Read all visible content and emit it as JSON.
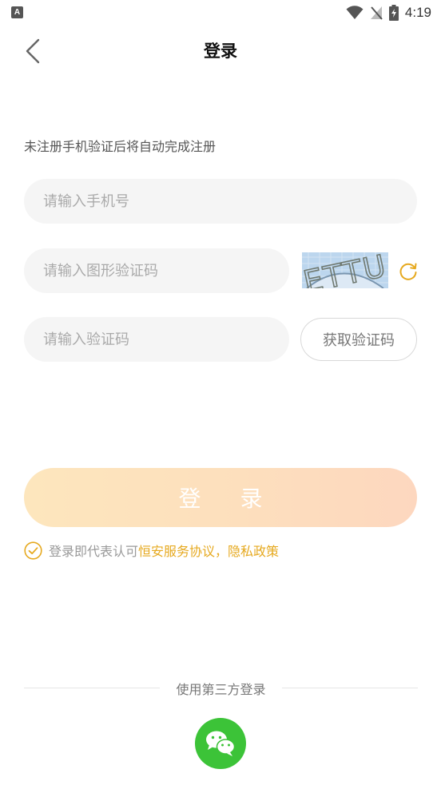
{
  "status_bar": {
    "notification_badge": "A",
    "time": "4:19"
  },
  "header": {
    "title": "登录"
  },
  "form": {
    "hint": "未注册手机验证后将自动完成注册",
    "phone_placeholder": "请输入手机号",
    "captcha_placeholder": "请输入图形验证码",
    "captcha_text": "ETTU",
    "code_placeholder": "请输入验证码",
    "get_code_label": "获取验证码"
  },
  "login_button": {
    "label": "登 录"
  },
  "agreement": {
    "prefix": "登录即代表认可",
    "terms_link": "恒安服务协议",
    "separator": "，",
    "privacy_link": "隐私政策"
  },
  "third_party": {
    "label": "使用第三方登录",
    "wechat_icon": "wechat-icon"
  },
  "colors": {
    "accent": "#e6a91f",
    "login_gradient_start": "#fde6bd",
    "login_gradient_end": "#fdd7bf",
    "wechat_green": "#3cc338"
  }
}
